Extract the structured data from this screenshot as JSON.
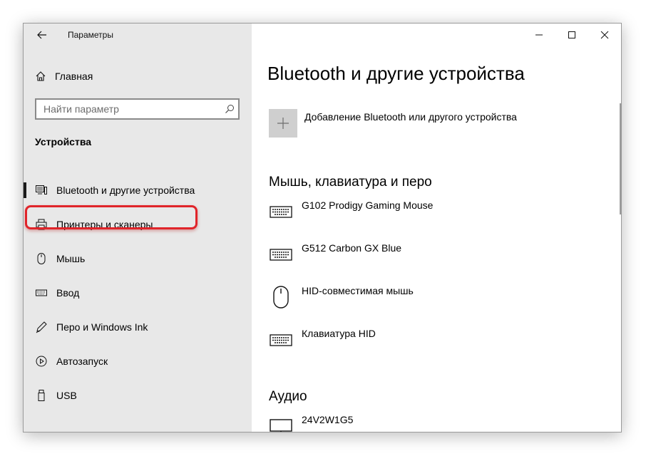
{
  "window": {
    "app_title": "Параметры"
  },
  "sidebar": {
    "home_label": "Главная",
    "search_placeholder": "Найти параметр",
    "section_heading": "Устройства",
    "items": [
      {
        "label": "Bluetooth и другие устройства",
        "icon": "devices-icon",
        "active": true
      },
      {
        "label": "Принтеры и сканеры",
        "icon": "printer-icon",
        "active": false,
        "highlighted": true
      },
      {
        "label": "Мышь",
        "icon": "mouse-icon",
        "active": false
      },
      {
        "label": "Ввод",
        "icon": "keyboard-icon",
        "active": false
      },
      {
        "label": "Перо и Windows Ink",
        "icon": "pen-icon",
        "active": false
      },
      {
        "label": "Автозапуск",
        "icon": "autoplay-icon",
        "active": false
      },
      {
        "label": "USB",
        "icon": "usb-icon",
        "active": false
      }
    ]
  },
  "main": {
    "page_title": "Bluetooth и другие устройства",
    "add_device_label": "Добавление Bluetooth или другого устройства",
    "groups": [
      {
        "heading": "Мышь, клавиатура и перо",
        "devices": [
          {
            "name": "G102 Prodigy Gaming Mouse",
            "icon": "keyboard-icon"
          },
          {
            "name": "G512 Carbon GX Blue",
            "icon": "keyboard-icon"
          },
          {
            "name": "HID-совместимая мышь",
            "icon": "mouse-icon"
          },
          {
            "name": "Клавиатура HID",
            "icon": "keyboard-icon"
          }
        ]
      },
      {
        "heading": "Аудио",
        "devices": [
          {
            "name": "24V2W1G5",
            "icon": "monitor-icon"
          }
        ]
      }
    ]
  },
  "colors": {
    "sidebar_bg": "#e8e8e8",
    "highlight_border": "#e0242a",
    "add_tile_bg": "#cfcfcf"
  }
}
